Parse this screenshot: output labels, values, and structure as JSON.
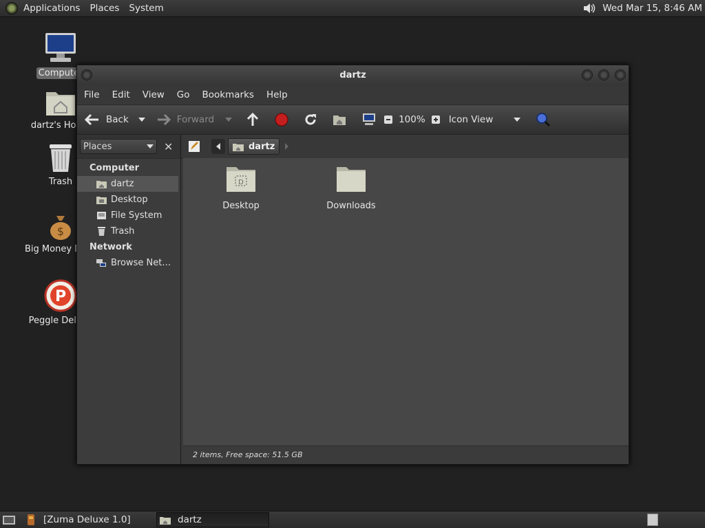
{
  "top_panel": {
    "applications": "Applications",
    "places": "Places",
    "system": "System",
    "clock": "Wed Mar 15,  8:46 AM",
    "volume_icon": "speaker-icon"
  },
  "desktop_icons": [
    {
      "label": "Computer",
      "icon": "computer-icon"
    },
    {
      "label": "dartz's Home",
      "icon": "home-folder-icon"
    },
    {
      "label": "Trash",
      "icon": "trash-icon"
    },
    {
      "label": "Big Money Deluxe",
      "icon": "money-bag-icon"
    },
    {
      "label": "Peggle Deluxe",
      "icon": "peggle-icon"
    }
  ],
  "window": {
    "title": "dartz",
    "menu": [
      "File",
      "Edit",
      "View",
      "Go",
      "Bookmarks",
      "Help"
    ],
    "toolbar": {
      "back": "Back",
      "forward": "Forward",
      "zoom": "100%",
      "view_mode": "Icon View"
    },
    "sidebar": {
      "selector": "Places",
      "sections": [
        {
          "heading": "Computer",
          "items": [
            {
              "label": "dartz",
              "icon": "home-icon",
              "selected": true
            },
            {
              "label": "Desktop",
              "icon": "desktop-icon",
              "selected": false
            },
            {
              "label": "File System",
              "icon": "drive-icon",
              "selected": false
            },
            {
              "label": "Trash",
              "icon": "trash-icon",
              "selected": false
            }
          ]
        },
        {
          "heading": "Network",
          "items": [
            {
              "label": "Browse Net…",
              "icon": "network-icon",
              "selected": false
            }
          ]
        }
      ]
    },
    "location": {
      "path_button": "dartz"
    },
    "files": [
      {
        "name": "Desktop",
        "icon": "desktop-folder-icon"
      },
      {
        "name": "Downloads",
        "icon": "folder-icon"
      }
    ],
    "status": "2 items, Free space: 51.5 GB"
  },
  "bottom_panel": {
    "tasks": [
      {
        "label": "[Zuma Deluxe 1.0]",
        "active": false
      },
      {
        "label": "dartz",
        "active": true
      }
    ]
  },
  "colors": {
    "desktop_bg": "#212121",
    "window_bg": "#474747",
    "selection": "#555555"
  }
}
